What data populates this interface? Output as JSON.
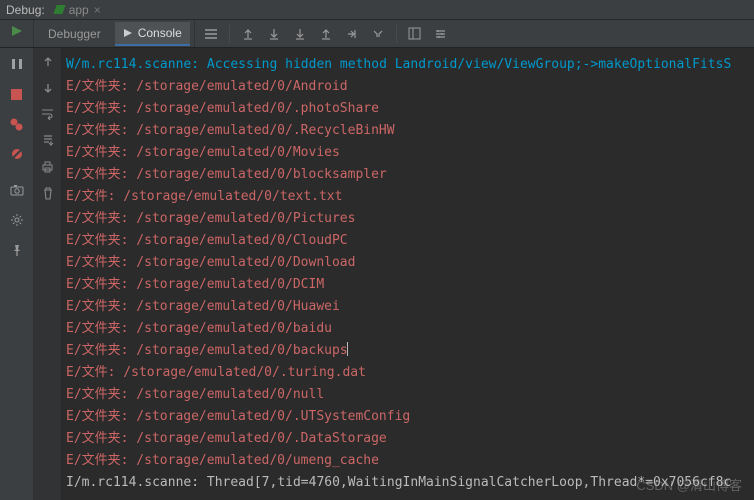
{
  "top": {
    "debug_label": "Debug:",
    "app_tab": "app",
    "app_close": "×"
  },
  "tabs": {
    "debugger": "Debugger",
    "console": "Console"
  },
  "console_lines": [
    {
      "cls": "wlog",
      "text": "W/m.rc114.scanne: Accessing hidden method Landroid/view/ViewGroup;->makeOptionalFitsS"
    },
    {
      "cls": "elog",
      "text": "E/文件夹: /storage/emulated/0/Android"
    },
    {
      "cls": "elog",
      "text": "E/文件夹: /storage/emulated/0/.photoShare"
    },
    {
      "cls": "elog",
      "text": "E/文件夹: /storage/emulated/0/.RecycleBinHW"
    },
    {
      "cls": "elog",
      "text": "E/文件夹: /storage/emulated/0/Movies"
    },
    {
      "cls": "elog",
      "text": "E/文件夹: /storage/emulated/0/blocksampler"
    },
    {
      "cls": "elog",
      "text": "E/文件: /storage/emulated/0/text.txt"
    },
    {
      "cls": "elog",
      "text": "E/文件夹: /storage/emulated/0/Pictures"
    },
    {
      "cls": "elog",
      "text": "E/文件夹: /storage/emulated/0/CloudPC"
    },
    {
      "cls": "elog",
      "text": "E/文件夹: /storage/emulated/0/Download"
    },
    {
      "cls": "elog",
      "text": "E/文件夹: /storage/emulated/0/DCIM"
    },
    {
      "cls": "elog",
      "text": "E/文件夹: /storage/emulated/0/Huawei"
    },
    {
      "cls": "elog",
      "text": "E/文件夹: /storage/emulated/0/baidu"
    },
    {
      "cls": "elog",
      "text": "E/文件夹: /storage/emulated/0/backups",
      "cursor": true
    },
    {
      "cls": "elog",
      "text": "E/文件: /storage/emulated/0/.turing.dat"
    },
    {
      "cls": "elog",
      "text": "E/文件夹: /storage/emulated/0/null"
    },
    {
      "cls": "elog",
      "text": "E/文件夹: /storage/emulated/0/.UTSystemConfig"
    },
    {
      "cls": "elog",
      "text": "E/文件夹: /storage/emulated/0/.DataStorage"
    },
    {
      "cls": "elog",
      "text": "E/文件夹: /storage/emulated/0/umeng_cache"
    },
    {
      "cls": "ilog",
      "text": "I/m.rc114.scanne: Thread[7,tid=4760,WaitingInMainSignalCatcherLoop,Thread*=0x7056cf8c"
    }
  ],
  "watermark": "CSDN @清山博客"
}
